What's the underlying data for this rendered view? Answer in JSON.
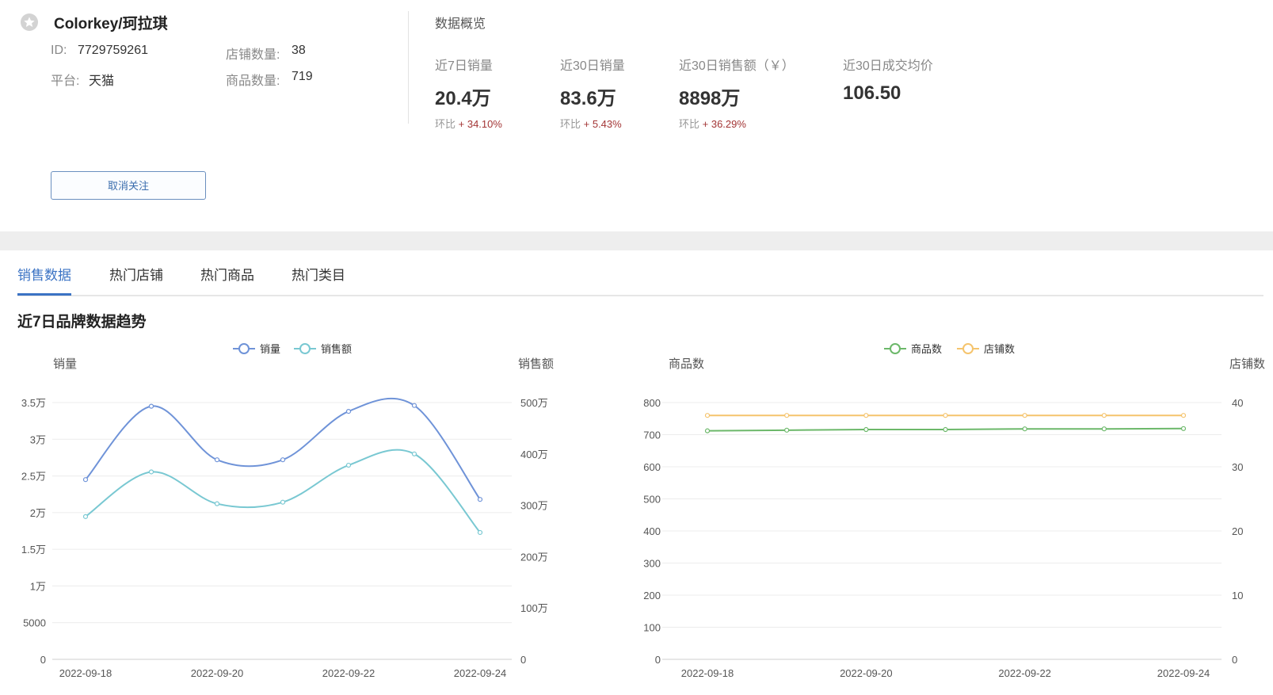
{
  "brand": {
    "name": "Colorkey/珂拉琪",
    "id_label": "ID:",
    "id_value": "7729759261",
    "shops_label": "店铺数量:",
    "shops_value": "38",
    "platform_label": "平台:",
    "platform_value": "天猫",
    "products_label": "商品数量:",
    "products_value": "719",
    "unfollow_label": "取消关注"
  },
  "overview": {
    "title": "数据概览",
    "change_label": "环比",
    "metrics": [
      {
        "label": "近7日销量",
        "value": "20.4万",
        "change": "+ 34.10%"
      },
      {
        "label": "近30日销量",
        "value": "83.6万",
        "change": "+ 5.43%"
      },
      {
        "label": "近30日销售额（￥）",
        "value": "8898万",
        "change": "+ 36.29%"
      },
      {
        "label": "近30日成交均价",
        "value": "106.50",
        "change": ""
      }
    ]
  },
  "tabs": [
    {
      "label": "销售数据",
      "active": true
    },
    {
      "label": "热门店铺",
      "active": false
    },
    {
      "label": "热门商品",
      "active": false
    },
    {
      "label": "热门类目",
      "active": false
    }
  ],
  "section_title": "近7日品牌数据趋势",
  "colors": {
    "accent": "#3b73c4",
    "sales_line": "#6f93d8",
    "revenue_line": "#79c8d2",
    "products_line": "#6cb86a",
    "shops_line": "#f5c46d",
    "negative_change": "#a33535"
  },
  "chart_data": [
    {
      "type": "line",
      "smooth": true,
      "x": [
        "2022-09-18",
        "2022-09-19",
        "2022-09-20",
        "2022-09-21",
        "2022-09-22",
        "2022-09-23",
        "2022-09-24"
      ],
      "x_tick_labels": [
        "2022-09-18",
        "2022-09-20",
        "2022-09-22",
        "2022-09-24"
      ],
      "legend": [
        "销量",
        "销售额"
      ],
      "legend_position": "top-center",
      "ylabel_left": "销量",
      "ylabel_right": "销售额",
      "ylim_left": [
        0,
        35000
      ],
      "ylim_right": [
        0,
        5000000
      ],
      "y_ticks_left": [
        "0",
        "5000",
        "1万",
        "1.5万",
        "2万",
        "2.5万",
        "3万",
        "3.5万"
      ],
      "y_ticks_right": [
        "0",
        "100万",
        "200万",
        "300万",
        "400万",
        "500万"
      ],
      "grid": true,
      "series": [
        {
          "name": "销量",
          "axis": "left",
          "values": [
            24500,
            34500,
            27200,
            27200,
            33800,
            34600,
            21800
          ]
        },
        {
          "name": "销售额",
          "axis": "right",
          "values": [
            2780000,
            3650000,
            3030000,
            3060000,
            3780000,
            4000000,
            2470000
          ]
        }
      ]
    },
    {
      "type": "line",
      "smooth": false,
      "x": [
        "2022-09-18",
        "2022-09-19",
        "2022-09-20",
        "2022-09-21",
        "2022-09-22",
        "2022-09-23",
        "2022-09-24"
      ],
      "x_tick_labels": [
        "2022-09-18",
        "2022-09-20",
        "2022-09-22",
        "2022-09-24"
      ],
      "legend": [
        "商品数",
        "店铺数"
      ],
      "legend_position": "top-center",
      "ylabel_left": "商品数",
      "ylabel_right": "店铺数",
      "ylim_left": [
        0,
        800
      ],
      "ylim_right": [
        0,
        40
      ],
      "y_ticks_left": [
        "0",
        "100",
        "200",
        "300",
        "400",
        "500",
        "600",
        "700",
        "800"
      ],
      "y_ticks_right": [
        "0",
        "10",
        "20",
        "30",
        "40"
      ],
      "grid": true,
      "series": [
        {
          "name": "商品数",
          "axis": "left",
          "values": [
            712,
            714,
            716,
            716,
            718,
            718,
            719
          ]
        },
        {
          "name": "店铺数",
          "axis": "right",
          "values": [
            38,
            38,
            38,
            38,
            38,
            38,
            38
          ]
        }
      ]
    }
  ]
}
